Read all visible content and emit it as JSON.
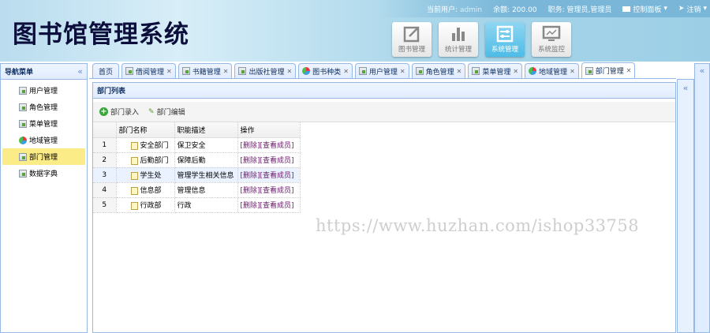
{
  "header": {
    "logo": "图书馆管理系统",
    "user_label": "当前用户:",
    "user": "admin",
    "balance_label": "余额:",
    "balance": "200.00",
    "role_label": "职务:",
    "role": "管理员,管理员",
    "control_panel": "控制面板",
    "logout": "注销",
    "modules": [
      {
        "label": "图书管理",
        "icon": "edit-icon"
      },
      {
        "label": "统计管理",
        "icon": "bar-chart-icon"
      },
      {
        "label": "系统管理",
        "icon": "settings-icon",
        "active": true
      },
      {
        "label": "系统监控",
        "icon": "monitor-icon"
      }
    ]
  },
  "sidebar": {
    "title": "导航菜单",
    "items": [
      {
        "label": "用户管理"
      },
      {
        "label": "角色管理"
      },
      {
        "label": "菜单管理"
      },
      {
        "label": "地域管理"
      },
      {
        "label": "部门管理",
        "selected": true
      },
      {
        "label": "数据字典"
      }
    ]
  },
  "tabs": [
    {
      "label": "首页"
    },
    {
      "label": "借阅管理"
    },
    {
      "label": "书籍管理"
    },
    {
      "label": "出版社管理"
    },
    {
      "label": "图书种类"
    },
    {
      "label": "用户管理"
    },
    {
      "label": "角色管理"
    },
    {
      "label": "菜单管理"
    },
    {
      "label": "地域管理"
    },
    {
      "label": "部门管理",
      "active": true
    }
  ],
  "panel": {
    "title": "部门列表",
    "add": "部门录入",
    "edit": "部门编辑",
    "columns": [
      "部门名称",
      "职能描述",
      "操作"
    ],
    "rows": [
      {
        "n": "1",
        "name": "安全部门",
        "desc": "保卫安全"
      },
      {
        "n": "2",
        "name": "后勤部门",
        "desc": "保障后勤"
      },
      {
        "n": "3",
        "name": "学生处",
        "desc": "管理学生相关信息"
      },
      {
        "n": "4",
        "name": "信息部",
        "desc": "管理信息"
      },
      {
        "n": "5",
        "name": "行政部",
        "desc": "行政"
      }
    ],
    "op_delete": "[删除]",
    "op_members": "[查看成员]"
  },
  "collapse_glyph": "«",
  "watermark": "https://www.huzhan.com/ishop33758"
}
